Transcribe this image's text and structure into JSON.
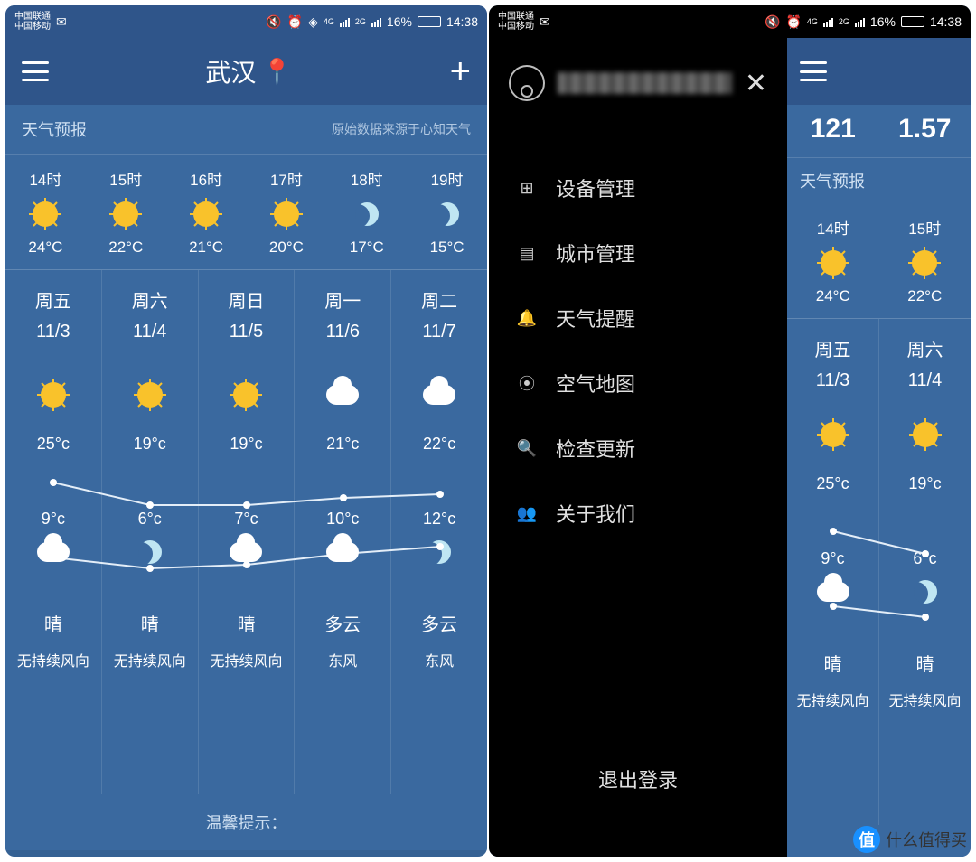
{
  "status": {
    "carrier1": "中国联通",
    "carrier2": "中国移动",
    "net1": "4G",
    "net2": "2G",
    "battery_pct": "16%",
    "time": "14:38"
  },
  "left": {
    "city": "武汉",
    "section_title": "天气预报",
    "source": "原始数据来源于心知天气",
    "hourly": [
      {
        "time": "14时",
        "icon": "sun",
        "temp": "24°C"
      },
      {
        "time": "15时",
        "icon": "sun",
        "temp": "22°C"
      },
      {
        "time": "16时",
        "icon": "sun",
        "temp": "21°C"
      },
      {
        "time": "17时",
        "icon": "sun",
        "temp": "20°C"
      },
      {
        "time": "18时",
        "icon": "moon",
        "temp": "17°C"
      },
      {
        "time": "19时",
        "icon": "moon",
        "temp": "15°C"
      }
    ],
    "daily": [
      {
        "dow": "周五",
        "date": "11/3",
        "dayIcon": "sun",
        "hi": "25°c",
        "lo": "9°c",
        "nightIcon": "cloud",
        "cond": "晴",
        "wind": "无持续风向"
      },
      {
        "dow": "周六",
        "date": "11/4",
        "dayIcon": "sun",
        "hi": "19°c",
        "lo": "6°c",
        "nightIcon": "moon",
        "cond": "晴",
        "wind": "无持续风向"
      },
      {
        "dow": "周日",
        "date": "11/5",
        "dayIcon": "sun",
        "hi": "19°c",
        "lo": "7°c",
        "nightIcon": "cloud",
        "cond": "晴",
        "wind": "无持续风向"
      },
      {
        "dow": "周一",
        "date": "11/6",
        "dayIcon": "cloud",
        "hi": "21°c",
        "lo": "10°c",
        "nightIcon": "cloud",
        "cond": "多云",
        "wind": "东风"
      },
      {
        "dow": "周二",
        "date": "11/7",
        "dayIcon": "cloud",
        "hi": "22°c",
        "lo": "12°c",
        "nightIcon": "moon",
        "cond": "多云",
        "wind": "东风"
      }
    ],
    "tip": "温馨提示："
  },
  "right": {
    "menu": [
      {
        "icon": "⊞",
        "label": "设备管理"
      },
      {
        "icon": "▤",
        "label": "城市管理"
      },
      {
        "icon": "🔔",
        "label": "天气提醒"
      },
      {
        "icon": "⦿",
        "label": "空气地图"
      },
      {
        "icon": "🔍",
        "label": "检查更新"
      },
      {
        "icon": "👥",
        "label": "关于我们"
      }
    ],
    "logout": "退出登录",
    "nums": [
      "121",
      "1.57"
    ],
    "section_title": "天气预报",
    "hourly": [
      {
        "time": "14时",
        "icon": "sun",
        "temp": "24°C"
      },
      {
        "time": "15时",
        "icon": "sun",
        "temp": "22°C"
      }
    ],
    "daily": [
      {
        "dow": "周五",
        "date": "11/3",
        "dayIcon": "sun",
        "hi": "25°c",
        "lo": "9°c",
        "nightIcon": "cloud",
        "cond": "晴",
        "wind": "无持续风向"
      },
      {
        "dow": "周六",
        "date": "11/4",
        "dayIcon": "sun",
        "hi": "19°c",
        "lo": "6°c",
        "nightIcon": "moon",
        "cond": "晴",
        "wind": "无持续风向"
      }
    ]
  },
  "watermark": "什么值得买",
  "wm_badge": "值",
  "chart_data": {
    "type": "line",
    "categories": [
      "11/3",
      "11/4",
      "11/5",
      "11/6",
      "11/7"
    ],
    "series": [
      {
        "name": "high",
        "values": [
          25,
          19,
          19,
          21,
          22
        ]
      },
      {
        "name": "low",
        "values": [
          9,
          6,
          7,
          10,
          12
        ]
      }
    ],
    "ylabel": "°C",
    "ylim": [
      0,
      30
    ]
  }
}
